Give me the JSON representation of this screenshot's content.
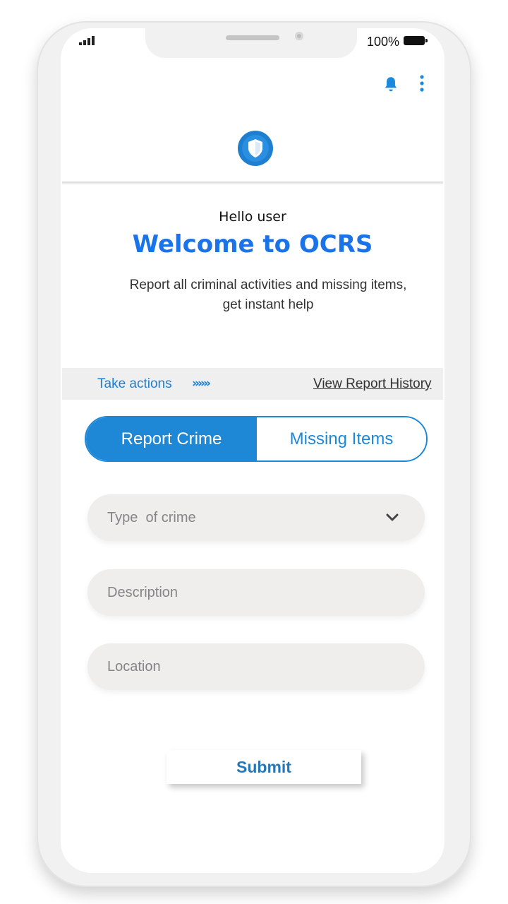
{
  "status_bar": {
    "battery_label": "100%",
    "battery_level": 1.0
  },
  "header": {
    "icons": [
      "bell-icon",
      "more-vert-icon",
      "shield-logo-icon"
    ],
    "accent_color": "#1a73e8"
  },
  "hero": {
    "greeting": "Hello user",
    "title": "Welcome to OCRS",
    "tagline_line1": "Report all criminal activities and missing items,",
    "tagline_line2": "get instant help"
  },
  "action_bar": {
    "take_actions_label": "Take actions",
    "chevrons": "»»»",
    "history_link": "View Report History"
  },
  "tabs": [
    {
      "label": "Report Crime",
      "active": true
    },
    {
      "label": "Missing Items",
      "active": false
    }
  ],
  "form": {
    "type_select": {
      "label": "Type  of crime",
      "icon": "chevron-down-icon"
    },
    "description": {
      "placeholder": "Description",
      "value": ""
    },
    "location": {
      "placeholder": "Location",
      "value": ""
    },
    "submit_label": "Submit"
  },
  "colors": {
    "primary": "#1e88d6",
    "link": "#1e7fd1",
    "submit_text": "#2577b8",
    "field_bg": "#efeeed"
  }
}
